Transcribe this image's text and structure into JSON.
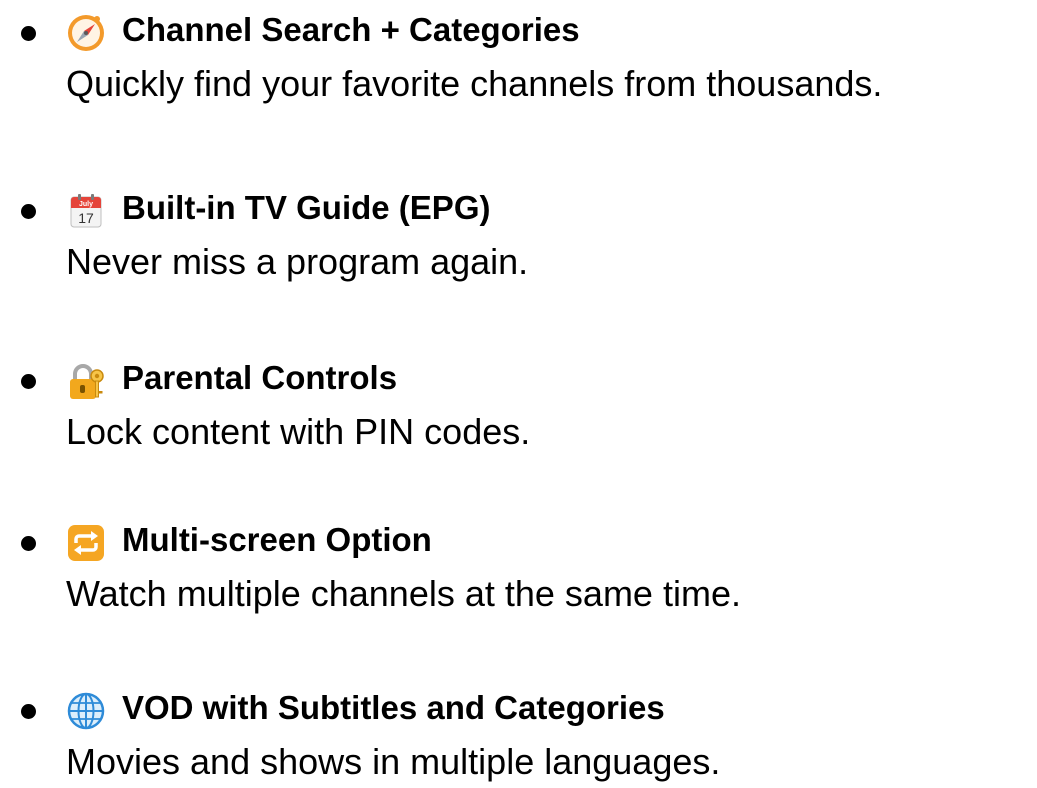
{
  "features": [
    {
      "icon": "compass-icon",
      "title": "Channel Search + Categories",
      "description": "Quickly find your favorite channels from thousands."
    },
    {
      "icon": "calendar-icon",
      "title": "Built-in TV Guide (EPG)",
      "description": "Never miss a program again.",
      "icon_text": {
        "month": "July",
        "day": "17"
      }
    },
    {
      "icon": "lock-with-key-icon",
      "title": "Parental Controls",
      "description": "Lock content with PIN codes."
    },
    {
      "icon": "repeat-arrows-icon",
      "title": "Multi-screen Option",
      "description": "Watch multiple channels at the same time."
    },
    {
      "icon": "globe-icon",
      "title": "VOD with Subtitles and Categories",
      "description": "Movies and shows in multiple languages."
    }
  ],
  "colors": {
    "text": "#000000",
    "compass_orange": "#F39A2B",
    "calendar_red": "#E5443A",
    "lock_gold": "#F2A81D",
    "repeat_orange": "#F5A623",
    "globe_blue": "#2E8BD8"
  }
}
